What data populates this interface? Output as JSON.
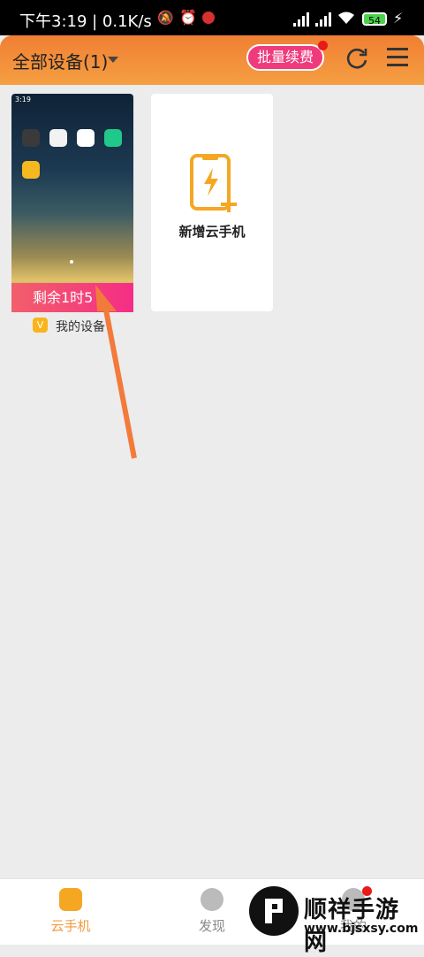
{
  "status_bar": {
    "time": "下午3:19 | 0.1K/s",
    "battery": "54"
  },
  "header": {
    "title": "全部设备(1)",
    "renew_button": "批量续费"
  },
  "device_card": {
    "remaining_label": "剩余1时5",
    "name": "我的设备",
    "badge": "V"
  },
  "add_card": {
    "label": "新增云手机"
  },
  "tabs": [
    {
      "label": "云手机",
      "active": true
    },
    {
      "label": "发现",
      "active": false
    },
    {
      "label": "我的",
      "active": false
    }
  ],
  "watermark": {
    "title": "顺祥手游网",
    "sub": "www.bjsxsy.com"
  },
  "colors": {
    "accent": "#f59a3d",
    "pink": "#ef3a7b",
    "arrow": "#f27b3c",
    "tab_active": "#f59a3d"
  }
}
